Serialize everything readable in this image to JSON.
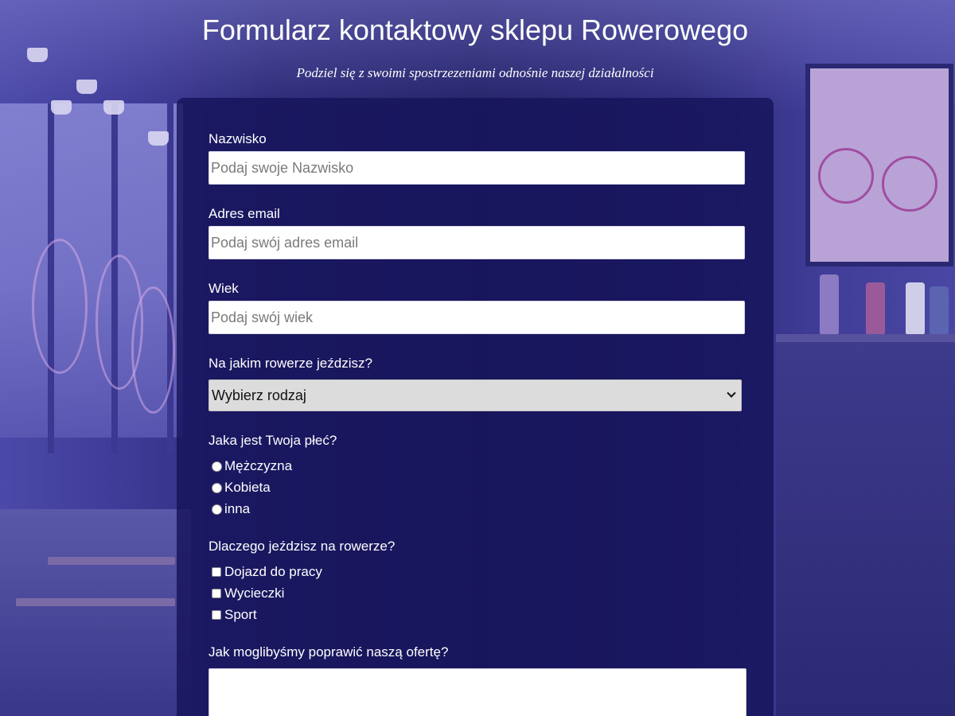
{
  "header": {
    "title": "Formularz kontaktowy sklepu Rowerowego",
    "subtitle": "Podziel się z swoimi spostrzezeniami odnośnie naszej działalności"
  },
  "form": {
    "name": {
      "label": "Nazwisko",
      "value": "",
      "placeholder": "Podaj swoje Nazwisko"
    },
    "email": {
      "label": "Adres email",
      "value": "",
      "placeholder": "Podaj swój adres email"
    },
    "age": {
      "label": "Wiek",
      "value": "",
      "placeholder": "Podaj swój wiek"
    },
    "bike_type": {
      "label": "Na jakim rowerze jeździsz?",
      "selected": "Wybierz rodzaj"
    },
    "gender": {
      "label": "Jaka jest Twoja płeć?",
      "options": [
        "Mężczyzna",
        "Kobieta",
        "inna"
      ]
    },
    "reasons": {
      "label": "Dlaczego jeździsz na rowerze?",
      "options": [
        "Dojazd do pracy",
        "Wycieczki",
        "Sport"
      ]
    },
    "improve": {
      "label": "Jak moglibyśmy poprawić naszą ofertę?",
      "value": ""
    }
  },
  "icons": {
    "select_arrow": "chevron-down-icon"
  }
}
